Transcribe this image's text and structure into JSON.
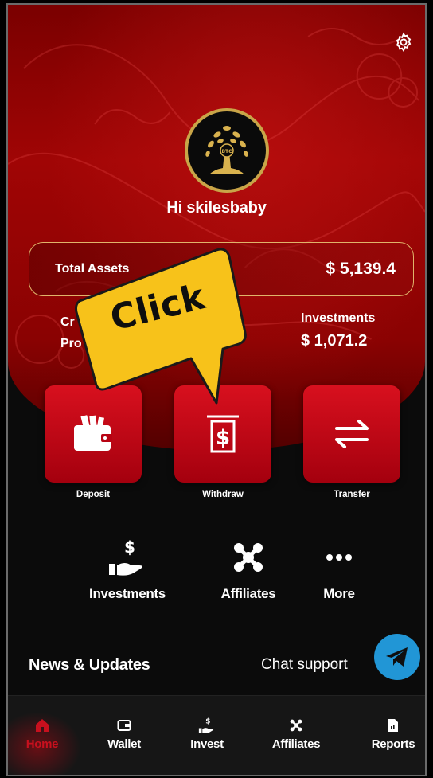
{
  "user": {
    "greeting": "Hi skilesbaby",
    "avatar_text": "BTC"
  },
  "summary": {
    "total_label": "Total Assets",
    "total_value": "$ 5,139.4",
    "left_label_line1": "Cr",
    "left_label_line2": "Pro",
    "investments_label": "Investments",
    "investments_value": "$ 1,071.2"
  },
  "actions": [
    {
      "label": "Deposit",
      "icon": "wallet-icon"
    },
    {
      "label": "Withdraw",
      "icon": "withdraw-dollar-icon"
    },
    {
      "label": "Transfer",
      "icon": "transfer-arrows-icon"
    }
  ],
  "quick_links": [
    {
      "label": "Investments",
      "icon": "invest-hand-icon"
    },
    {
      "label": "Affiliates",
      "icon": "affiliates-icon"
    },
    {
      "label": "More",
      "icon": "more-dots-icon"
    }
  ],
  "news": {
    "title": "News & Updates"
  },
  "chat": {
    "label": "Chat support",
    "icon": "telegram-icon"
  },
  "nav": [
    {
      "label": "Home",
      "icon": "home-icon",
      "active": true
    },
    {
      "label": "Wallet",
      "icon": "wallet-icon"
    },
    {
      "label": "Invest",
      "icon": "invest-hand-icon"
    },
    {
      "label": "Affiliates",
      "icon": "affiliates-icon"
    },
    {
      "label": "Reports",
      "icon": "reports-icon"
    }
  ],
  "annotation": {
    "text": "Click"
  },
  "colors": {
    "accent_red": "#c8101e",
    "gold": "#e0b46a",
    "callout_yellow": "#f7c21a",
    "chat_blue": "#2196d6"
  }
}
